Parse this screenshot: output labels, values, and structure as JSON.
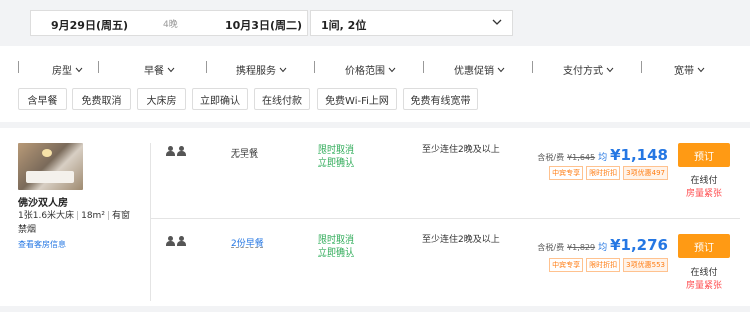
{
  "search": {
    "checkin": "9月29日(周五)",
    "nights": "4晚",
    "checkout": "10月3日(周二)",
    "guests": "1间, 2位",
    "dropdown_icon": "chevron-down-icon"
  },
  "filters": {
    "headers": [
      "房型",
      "早餐",
      "携程服务",
      "价格范围",
      "优惠促销",
      "支付方式",
      "宽带"
    ],
    "chips": [
      "含早餐",
      "免费取消",
      "大床房",
      "立即确认",
      "在线付款",
      "免费Wi-Fi上网",
      "免费有线宽带"
    ]
  },
  "room": {
    "name": "佛沙双人房",
    "bed": "1张1.6米大床",
    "area": "18m²",
    "window": "有窗",
    "smoking": "禁烟",
    "details_link": "查看客房信息"
  },
  "rates": [
    {
      "breakfast": "无早餐",
      "cancel": "限时取消",
      "confirm": "立即确认",
      "min_stay": "至少连住2晚及以上",
      "price_prefix": "含税/费",
      "original_price": "¥1,645",
      "avg_label": "均",
      "price": "¥1,148",
      "tags": [
        "中宾专享",
        "限时折扣",
        "3项优惠497"
      ],
      "book": "预订",
      "payment": "在线付",
      "status": "房量紧张"
    },
    {
      "breakfast": "2份早餐",
      "cancel": "限时取消",
      "confirm": "立即确认",
      "min_stay": "至少连住2晚及以上",
      "price_prefix": "含税/费",
      "original_price": "¥1,829",
      "avg_label": "均",
      "price": "¥1,276",
      "tags": [
        "中宾专享",
        "限时折扣",
        "3项优惠553"
      ],
      "book": "预订",
      "payment": "在线付",
      "status": "房量紧张"
    }
  ],
  "colors": {
    "accent": "#ff9a14",
    "price": "#2577e3",
    "policy": "#2eaa57",
    "warning": "#ff4d4f"
  }
}
